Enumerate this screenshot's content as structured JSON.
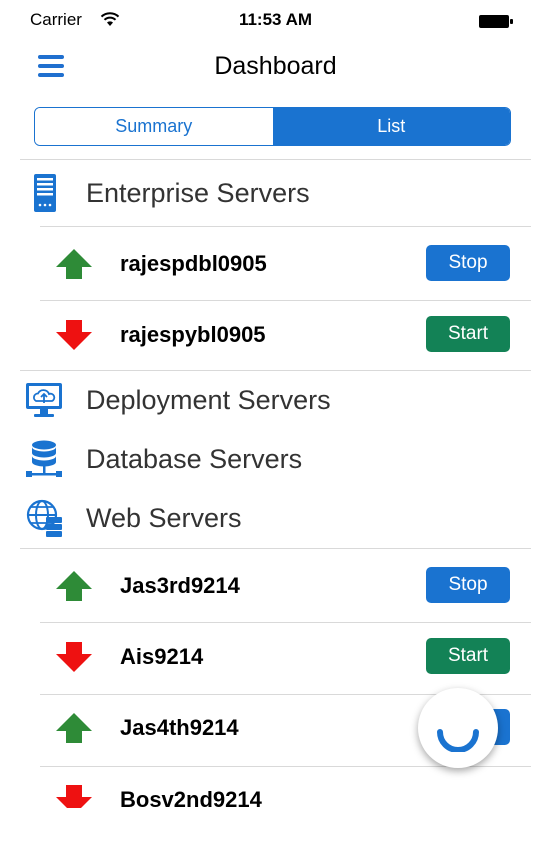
{
  "status_bar": {
    "carrier": "Carrier",
    "time": "11:53 AM"
  },
  "nav": {
    "title": "Dashboard"
  },
  "tabs": [
    {
      "label": "Summary",
      "selected": false
    },
    {
      "label": "List",
      "selected": true
    }
  ],
  "sections": [
    {
      "label": "Enterprise Servers",
      "icon": "server-icon"
    },
    {
      "label": "Deployment Servers",
      "icon": "cloud-monitor-icon"
    },
    {
      "label": "Database Servers",
      "icon": "database-icon"
    },
    {
      "label": "Web Servers",
      "icon": "globe-server-icon"
    }
  ],
  "enterprise_servers": [
    {
      "name": "rajespdbl0905",
      "status": "up",
      "action": "Stop"
    },
    {
      "name": "rajespybl0905",
      "status": "down",
      "action": "Start"
    }
  ],
  "web_servers": [
    {
      "name": "Jas3rd9214",
      "status": "up",
      "action": "Stop"
    },
    {
      "name": "Ais9214",
      "status": "down",
      "action": "Start"
    },
    {
      "name": "Jas4th9214",
      "status": "up",
      "action": "Stop"
    },
    {
      "name": "Bosv2nd9214",
      "status": "down",
      "action": ""
    }
  ],
  "colors": {
    "accent": "#1a73d0",
    "start": "#138256",
    "up_arrow": "#2e8b37",
    "down_arrow": "#ee1111"
  }
}
